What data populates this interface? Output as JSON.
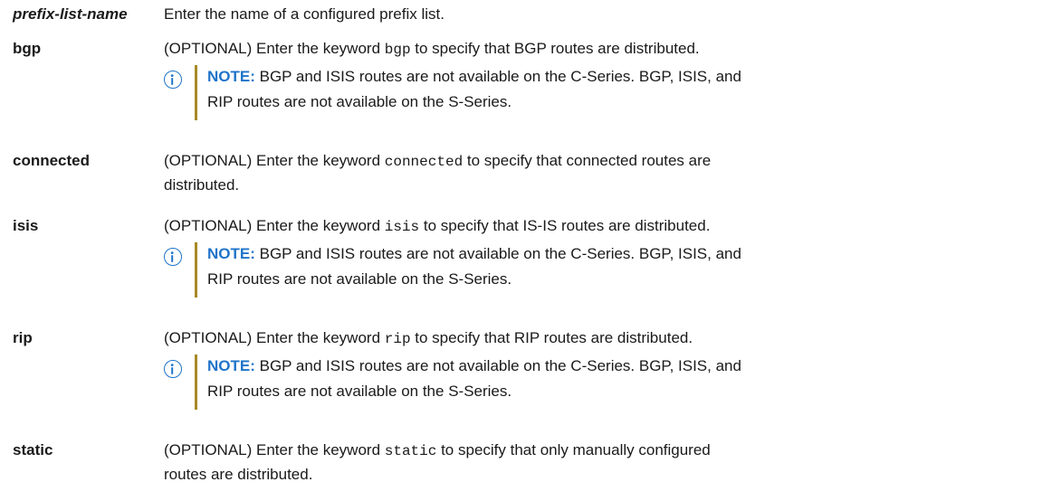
{
  "rows": [
    {
      "term": "prefix-list-name",
      "text_before": "Enter the name of a configured prefix list.",
      "keyword": "",
      "text_after": ""
    },
    {
      "term": "bgp",
      "text_before": "(OPTIONAL) Enter the keyword ",
      "keyword": "bgp",
      "text_after": " to specify that BGP routes are distributed.",
      "note": {
        "label": "NOTE:",
        "line1": " BGP and ISIS routes are not available on the C-Series. BGP, ISIS, and",
        "line2": "RIP routes are not available on the S-Series."
      }
    },
    {
      "term": "connected",
      "text_before": "(OPTIONAL) Enter the keyword ",
      "keyword": "connected",
      "text_after": " to specify that connected routes are",
      "text_line2": "distributed."
    },
    {
      "term": "isis",
      "text_before": "(OPTIONAL) Enter the keyword ",
      "keyword": "isis",
      "text_after": " to specify that IS-IS routes are distributed.",
      "note": {
        "label": "NOTE:",
        "line1": " BGP and ISIS routes are not available on the C-Series. BGP, ISIS, and",
        "line2": "RIP routes are not available on the S-Series."
      }
    },
    {
      "term": "rip",
      "text_before": "(OPTIONAL) Enter the keyword ",
      "keyword": "rip",
      "text_after": " to specify that RIP routes are distributed.",
      "note": {
        "label": "NOTE:",
        "line1": " BGP and ISIS routes are not available on the C-Series. BGP, ISIS, and",
        "line2": "RIP routes are not available on the S-Series."
      }
    },
    {
      "term": "static",
      "text_before": "(OPTIONAL) Enter the keyword ",
      "keyword": "static",
      "text_after": " to specify that only manually configured",
      "text_line2": "routes are distributed."
    }
  ],
  "icons": {
    "note": "info-icon"
  },
  "colors": {
    "note_accent": "#1f74c9",
    "note_bar": "#a68a26"
  }
}
